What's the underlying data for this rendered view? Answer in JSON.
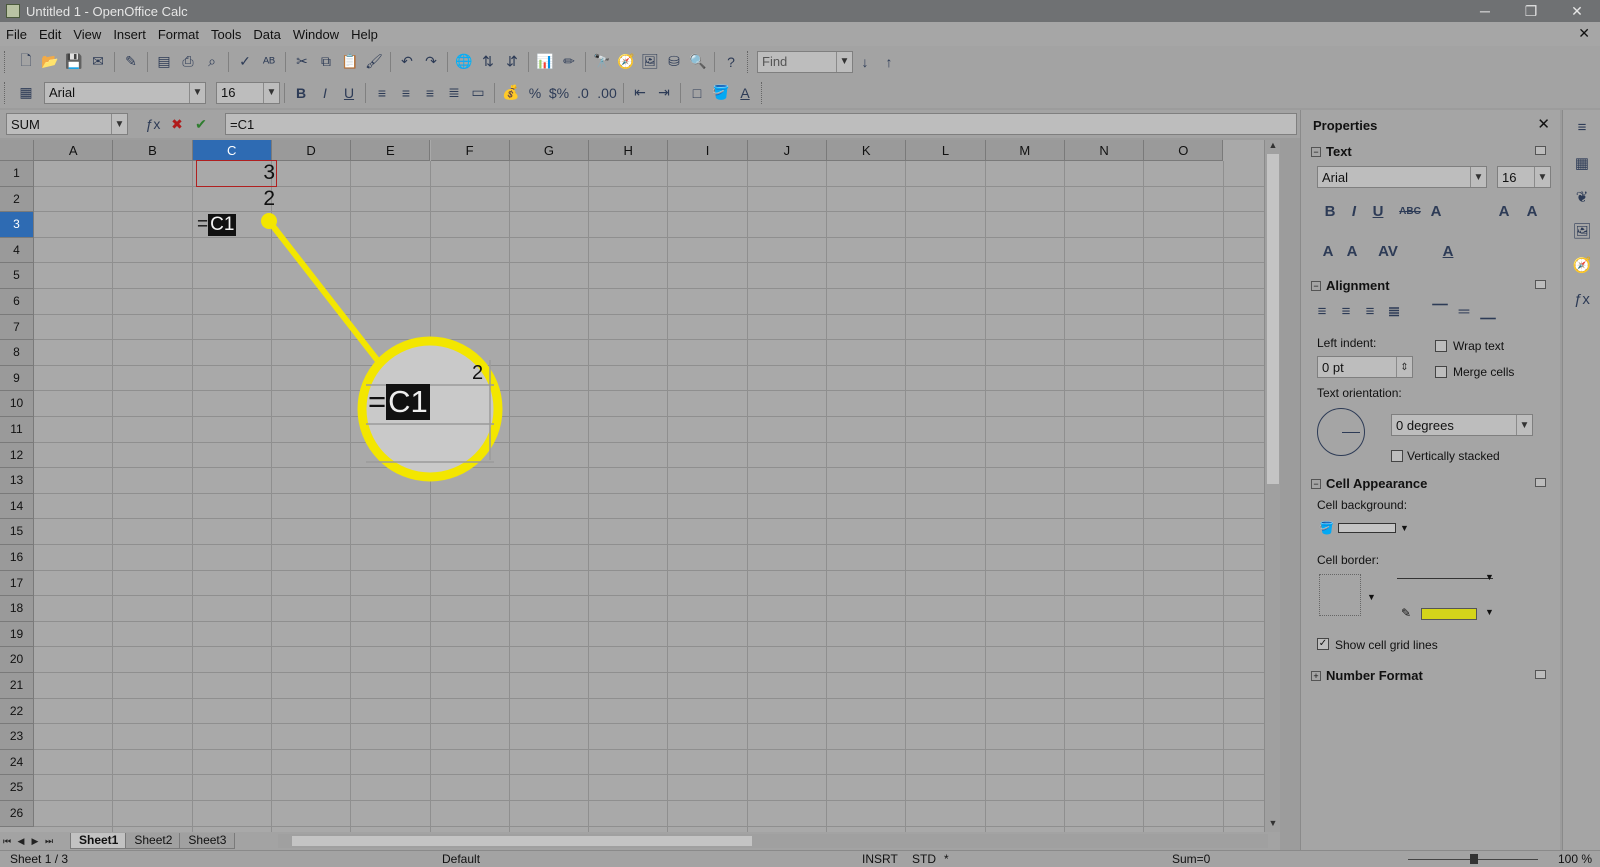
{
  "window": {
    "title": "Untitled 1 - OpenOffice Calc",
    "min_icon": "minimize-icon",
    "max_icon": "restore-icon",
    "close_icon": "close-icon"
  },
  "menu": {
    "items": [
      "File",
      "Edit",
      "View",
      "Insert",
      "Format",
      "Tools",
      "Data",
      "Window",
      "Help"
    ]
  },
  "find": {
    "placeholder": "Find"
  },
  "format_bar": {
    "font_name": "Arial",
    "font_size": "16"
  },
  "formula_bar": {
    "name_box": "SUM",
    "formula": "=C1"
  },
  "columns": [
    "A",
    "B",
    "C",
    "D",
    "E",
    "F",
    "G",
    "H",
    "I",
    "J",
    "K",
    "L",
    "M",
    "N",
    "O"
  ],
  "rows": [
    "1",
    "2",
    "3",
    "4",
    "5",
    "6",
    "7",
    "8",
    "9",
    "10",
    "11",
    "12",
    "13",
    "14",
    "15",
    "16",
    "17",
    "18",
    "19",
    "20",
    "21",
    "22",
    "23",
    "24",
    "25",
    "26"
  ],
  "cells": {
    "C1": "3",
    "C2": "2",
    "C3_prefix": "=",
    "C3_ref": "C1"
  },
  "callout": {
    "prefix": "=",
    "ref": "C1",
    "partial_digit": "2",
    "color": "#f3e600"
  },
  "sheets": {
    "tabs": [
      "Sheet1",
      "Sheet2",
      "Sheet3"
    ],
    "active": "Sheet1"
  },
  "status": {
    "sheet": "Sheet 1 / 3",
    "style": "Default",
    "mode1": "INSRT",
    "mode2": "STD",
    "mod": "*",
    "sum": "Sum=0",
    "zoom": "100 %"
  },
  "sidebar": {
    "title": "Properties",
    "text_section": "Text",
    "font_name": "Arial",
    "font_size": "16",
    "alignment_section": "Alignment",
    "left_indent_label": "Left indent:",
    "left_indent_value": "0 pt",
    "wrap_text": "Wrap text",
    "merge_cells": "Merge cells",
    "text_orientation_label": "Text orientation:",
    "orientation_value": "0 degrees",
    "vertically_stacked": "Vertically stacked",
    "cell_appearance_section": "Cell Appearance",
    "cell_background_label": "Cell background:",
    "cell_border_label": "Cell border:",
    "show_grid_lines": "Show cell grid lines",
    "number_format_section": "Number Format",
    "border_line_color": "#d4d41a"
  }
}
